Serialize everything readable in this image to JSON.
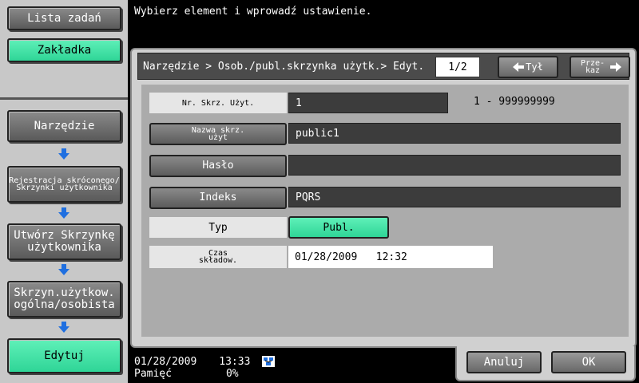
{
  "sidebar": {
    "job_list": "Lista zadań",
    "bookmark": "Zakładka",
    "steps": [
      "Narzędzie",
      "Rejestracja skróconego/ Skrzynki użytkownika",
      "Utwórz Skrzynkę użytkownika",
      "Skrzyn.użytkow. ogólna/osobista",
      "Edytuj"
    ]
  },
  "message": "Wybierz element i wprowadź ustawienie.",
  "header": {
    "breadcrumb": "Narzędzie > Osob./publ.skrzynka użytk.> Edyt.",
    "page": "1/2",
    "back_label": "Tył",
    "forward_label": "Prze- kaz"
  },
  "form": {
    "box_number": {
      "label": "Nr. Skrz. Użyt.",
      "value": "1",
      "range": "1 - 999999999"
    },
    "box_name": {
      "label": "Nazwa skrz. użyt",
      "value": "public1"
    },
    "password": {
      "label": "Hasło",
      "value": ""
    },
    "index": {
      "label": "Indeks",
      "value": "PQRS"
    },
    "type": {
      "label": "Typ",
      "value": "Publ."
    },
    "storage_time": {
      "label": "Czas składow.",
      "value": "01/28/2009   12:32"
    }
  },
  "status": {
    "date": "01/28/2009",
    "time": "13:33",
    "memory_label": "Pamięć",
    "memory_value": "0%"
  },
  "footer": {
    "cancel": "Anuluj",
    "ok": "OK"
  },
  "colors": {
    "accent_green": "#3ee0a4",
    "arrow_blue": "#1f6fe0"
  },
  "icons": [
    "arrow-down-icon",
    "arrow-left-icon",
    "arrow-right-icon",
    "network-tray-icon"
  ]
}
